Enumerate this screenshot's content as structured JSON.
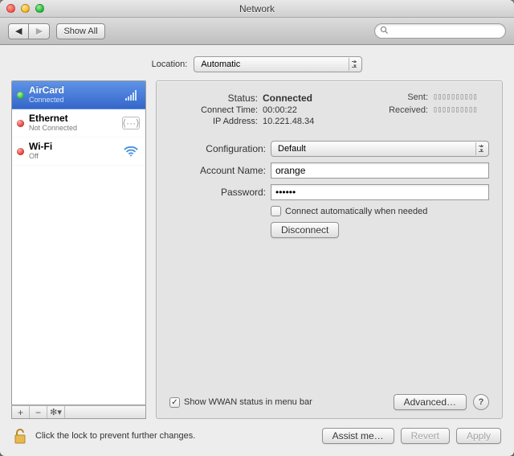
{
  "window": {
    "title": "Network"
  },
  "toolbar": {
    "back": "◀",
    "fwd": "▶",
    "showall": "Show All",
    "search_placeholder": ""
  },
  "location": {
    "label": "Location:",
    "value": "Automatic"
  },
  "sidebar": {
    "items": [
      {
        "name": "AirCard",
        "status": "Connected",
        "dot": "green",
        "selected": true,
        "icon": "signal"
      },
      {
        "name": "Ethernet",
        "status": "Not Connected",
        "dot": "red",
        "selected": false,
        "icon": "ethernet"
      },
      {
        "name": "Wi-Fi",
        "status": "Off",
        "dot": "red",
        "selected": false,
        "icon": "wifi"
      }
    ],
    "buttons": {
      "add": "+",
      "remove": "−",
      "gear": "✻▾"
    }
  },
  "status": {
    "label": "Status:",
    "value": "Connected",
    "connect_time_label": "Connect Time:",
    "connect_time": "00:00:22",
    "ip_label": "IP Address:",
    "ip": "10.221.48.34",
    "sent_label": "Sent:",
    "sent": "▯▯▯▯▯▯▯▯▯▯",
    "recv_label": "Received:",
    "recv": "▯▯▯▯▯▯▯▯▯▯"
  },
  "form": {
    "config_label": "Configuration:",
    "config_value": "Default",
    "account_label": "Account Name:",
    "account_value": "orange",
    "password_label": "Password:",
    "password_value": "••••••",
    "auto_label": "Connect automatically when needed",
    "auto_checked": false,
    "disconnect": "Disconnect"
  },
  "panelfoot": {
    "show_status_label": "Show WWAN status in menu bar",
    "show_status_checked": true,
    "advanced": "Advanced…",
    "help": "?"
  },
  "footer": {
    "lock_msg": "Click the lock to prevent further changes.",
    "assist": "Assist me…",
    "revert": "Revert",
    "apply": "Apply"
  }
}
